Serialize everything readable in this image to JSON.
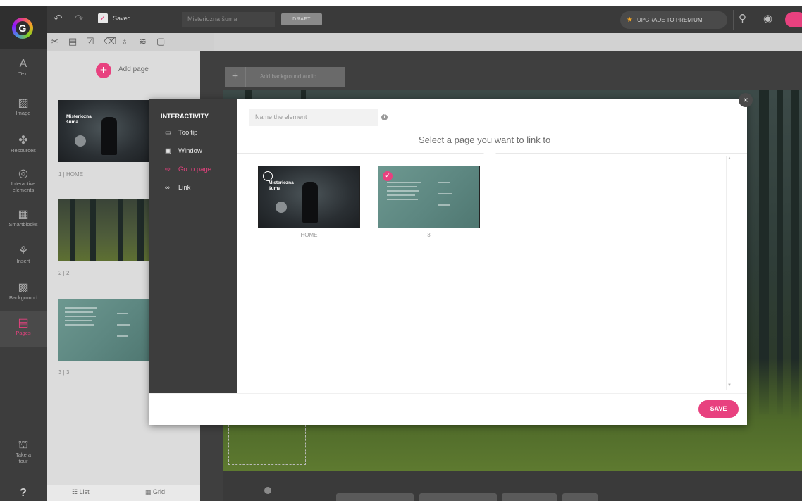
{
  "app": {
    "logo_letter": "G",
    "toolbar": {
      "saved_label": "Saved",
      "title_value": "Misteriozna šuma",
      "status_badge": "DRAFT",
      "upgrade_label": "UPGRADE TO PREMIUM"
    }
  },
  "sidebar": {
    "items": [
      {
        "label": "Text",
        "icon": "text-icon",
        "glyph": "A"
      },
      {
        "label": "Image",
        "icon": "image-icon",
        "glyph": "▨"
      },
      {
        "label": "Resources",
        "icon": "resources-icon",
        "glyph": "✤"
      },
      {
        "label": "Interactive elements",
        "icon": "interactive-icon",
        "glyph": "◎"
      },
      {
        "label": "Smartblocks",
        "icon": "smartblocks-icon",
        "glyph": "▦"
      },
      {
        "label": "Insert",
        "icon": "insert-icon",
        "glyph": "⚘"
      },
      {
        "label": "Background",
        "icon": "background-icon",
        "glyph": "▩"
      },
      {
        "label": "Pages",
        "icon": "pages-icon",
        "glyph": "▤"
      }
    ],
    "tour_label": "Take a tour",
    "help_glyph": "?"
  },
  "pages_panel": {
    "add_page_label": "Add page",
    "pages": [
      {
        "label": "1 | HOME"
      },
      {
        "label": "2 | 2"
      },
      {
        "label": "3 | 3"
      }
    ],
    "home_thumb_title": "Misteriozna šuma",
    "footer": {
      "list_label": "List",
      "grid_label": "Grid"
    }
  },
  "canvas": {
    "add_audio_label": "Add background audio"
  },
  "modal": {
    "menu_title": "INTERACTIVITY",
    "menu_items": [
      {
        "label": "Tooltip",
        "icon": "tooltip-icon",
        "glyph": "▭",
        "active": false
      },
      {
        "label": "Window",
        "icon": "window-icon",
        "glyph": "▣",
        "active": false
      },
      {
        "label": "Go to page",
        "icon": "go-to-page-icon",
        "glyph": "⇨",
        "active": true
      },
      {
        "label": "Link",
        "icon": "link-icon",
        "glyph": "∞",
        "active": false
      }
    ],
    "name_placeholder": "Name the element",
    "heading": "Select a page you want to link to",
    "pages": [
      {
        "label": "HOME",
        "selected": false
      },
      {
        "label": "3",
        "selected": true
      }
    ],
    "save_label": "SAVE"
  },
  "colors": {
    "accent": "#e8417f",
    "dark_panel": "#3d3d3d",
    "teal_page": "#5d8781"
  }
}
